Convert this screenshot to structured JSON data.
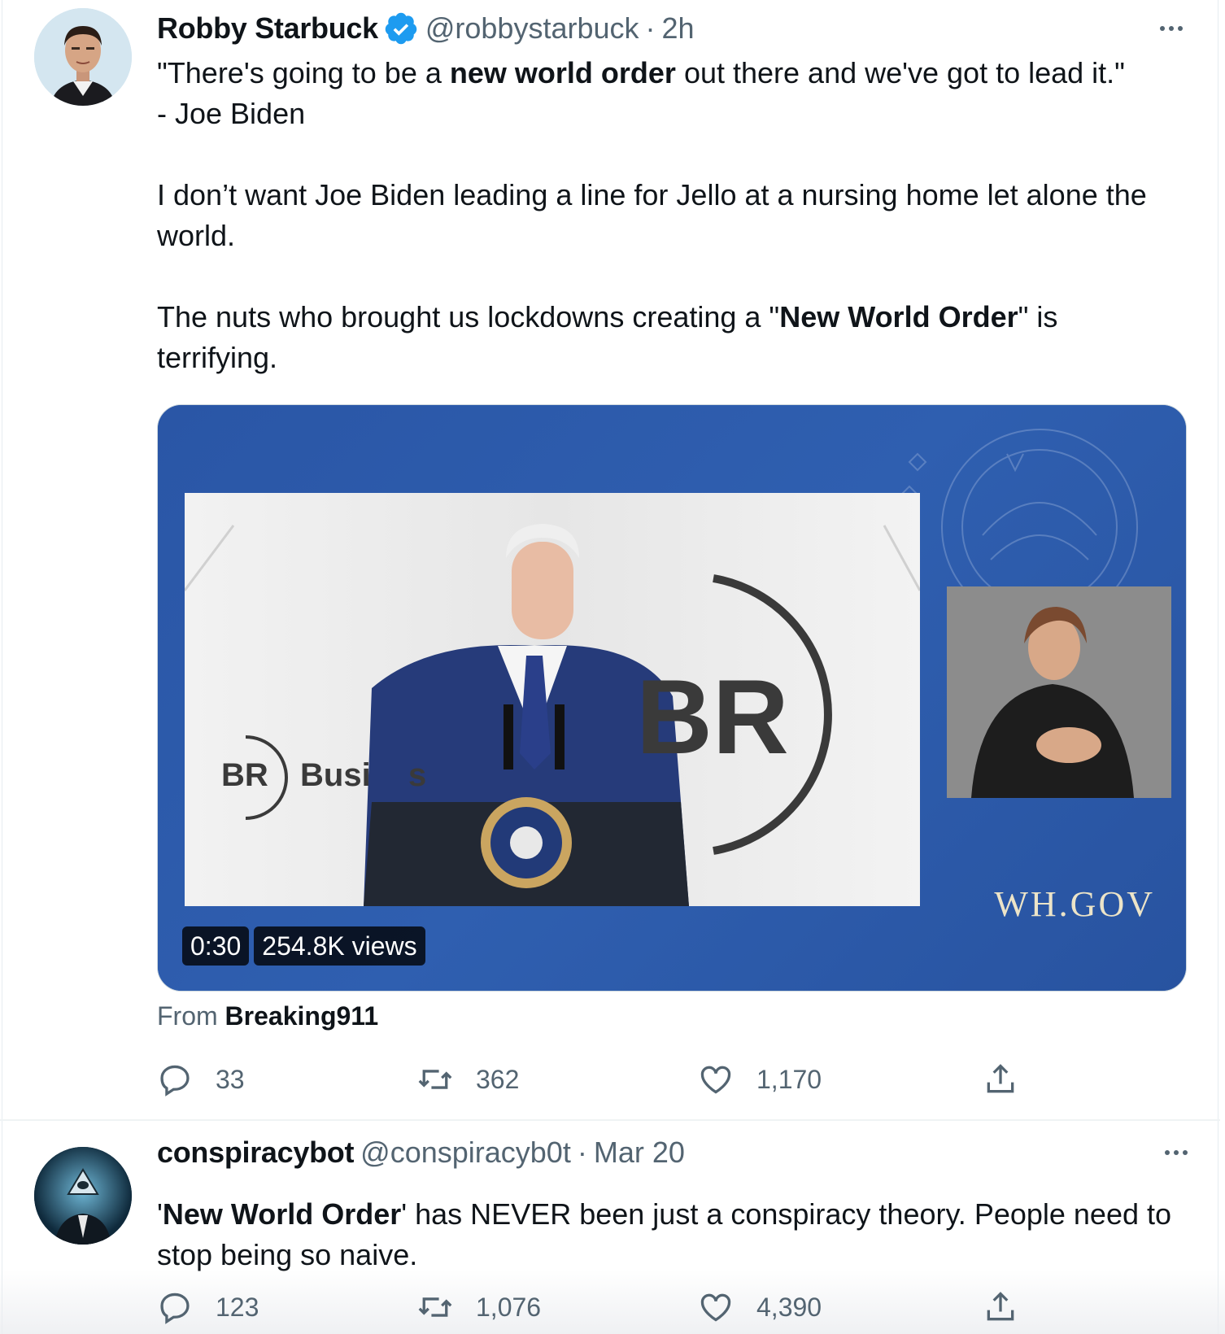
{
  "tweets": [
    {
      "author_name": "Robby Starbuck",
      "verified": true,
      "handle": "@robbystarbuck",
      "separator": "·",
      "time": "2h",
      "text": {
        "p1_a": "\"There's going to be a ",
        "p1_b": "new world order",
        "p1_c": " out there and we've got to lead it.\"",
        "p1_d": "- Joe Biden",
        "p2": "I don’t want Joe Biden leading a line for Jello at a nursing home let alone the world.",
        "p3_a": "The nuts who brought us lockdowns creating a \"",
        "p3_b": "New World Order",
        "p3_c": "\" is terrifying."
      },
      "media": {
        "duration": "0:30",
        "views": "254.8K views",
        "watermark": "WH.GOV",
        "stage_logo": "BR",
        "stage_label": "Busi",
        "stage_label_end": "s"
      },
      "attribution": {
        "prefix": "From ",
        "source": "Breaking911"
      },
      "stats": {
        "replies": "33",
        "retweets": "362",
        "likes": "1,170"
      }
    },
    {
      "author_name": "conspiracybot",
      "verified": false,
      "handle": "@conspiracyb0t",
      "separator": "·",
      "time": "Mar 20",
      "text": {
        "p1_a": "'",
        "p1_b": "New World Order",
        "p1_c": "' has NEVER been just a conspiracy theory. People need to stop being so naive."
      },
      "stats": {
        "replies": "123",
        "retweets": "1,076",
        "likes": "4,390"
      }
    }
  ],
  "icons": {
    "verified": "verified-badge-icon",
    "more": "more-options-icon",
    "reply": "reply-icon",
    "retweet": "retweet-icon",
    "like": "heart-icon",
    "share": "share-icon"
  },
  "colors": {
    "verified_blue": "#1d9bf0",
    "secondary_text": "#536471",
    "primary_text": "#0f1419",
    "media_blue": "#2d5aa8"
  }
}
